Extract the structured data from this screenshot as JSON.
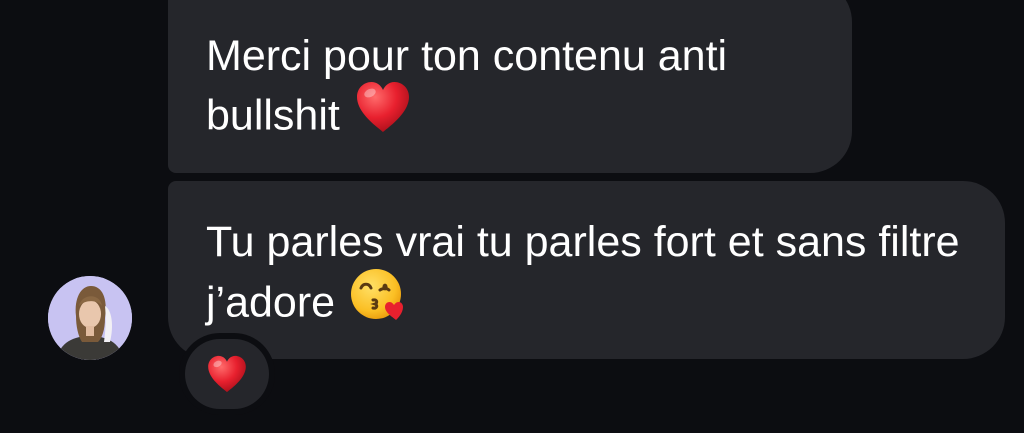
{
  "messages": [
    {
      "text": "Merci pour ton contenu anti bullshit",
      "emoji": "red-heart-icon"
    },
    {
      "text": "Tu parles vrai tu parles fort et sans filtre j’adore",
      "emoji": "face-blowing-kiss-icon",
      "reaction": "red-heart-icon"
    }
  ],
  "colors": {
    "background": "#0c0d11",
    "bubble": "#25262b",
    "text": "#ffffff",
    "heart": "#e8202e",
    "avatar_bg": "#c8c3f2"
  }
}
